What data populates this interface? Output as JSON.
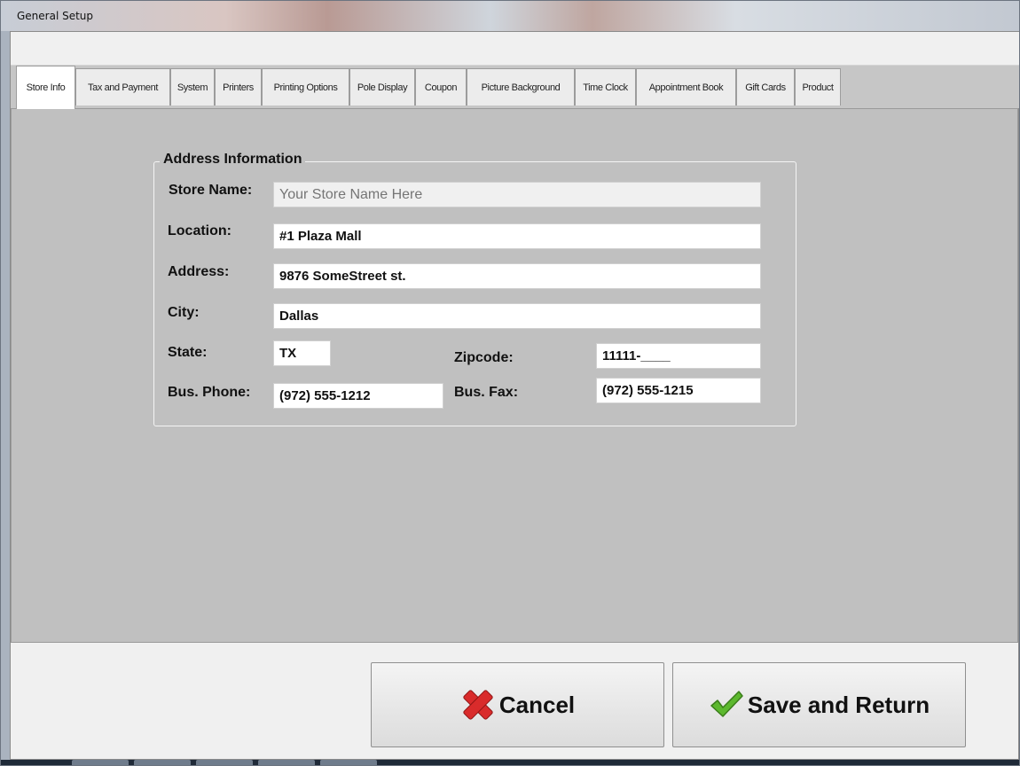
{
  "window": {
    "title": "General Setup"
  },
  "tabs": [
    {
      "label": "Store Info",
      "active": true
    },
    {
      "label": "Tax and Payment",
      "active": false
    },
    {
      "label": "System",
      "active": false
    },
    {
      "label": "Printers",
      "active": false
    },
    {
      "label": "Printing Options",
      "active": false
    },
    {
      "label": "Pole Display",
      "active": false
    },
    {
      "label": "Coupon",
      "active": false
    },
    {
      "label": "Picture Background",
      "active": false
    },
    {
      "label": "Time Clock",
      "active": false
    },
    {
      "label": "Appointment Book",
      "active": false
    },
    {
      "label": "Gift Cards",
      "active": false
    },
    {
      "label": "Product",
      "active": false
    }
  ],
  "address_info": {
    "legend": "Address Information",
    "store_name": {
      "label": "Store Name:",
      "placeholder": "Your Store Name Here",
      "value": ""
    },
    "location": {
      "label": "Location:",
      "value": "#1 Plaza Mall"
    },
    "address": {
      "label": "Address:",
      "value": "9876 SomeStreet st."
    },
    "city": {
      "label": "City:",
      "value": "Dallas"
    },
    "state": {
      "label": "State:",
      "value": "TX"
    },
    "zipcode": {
      "label": "Zipcode:",
      "value": "11111-____"
    },
    "bus_phone": {
      "label": "Bus. Phone:",
      "value": "(972) 555-1212"
    },
    "bus_fax": {
      "label": "Bus. Fax:",
      "value": "(972) 555-1215"
    }
  },
  "buttons": {
    "cancel": {
      "label": "Cancel",
      "icon": "red-x-icon"
    },
    "save": {
      "label": "Save and Return",
      "icon": "green-check-icon"
    }
  },
  "colors": {
    "cancel_icon": "#d92b2b",
    "save_icon": "#5cb82e"
  }
}
